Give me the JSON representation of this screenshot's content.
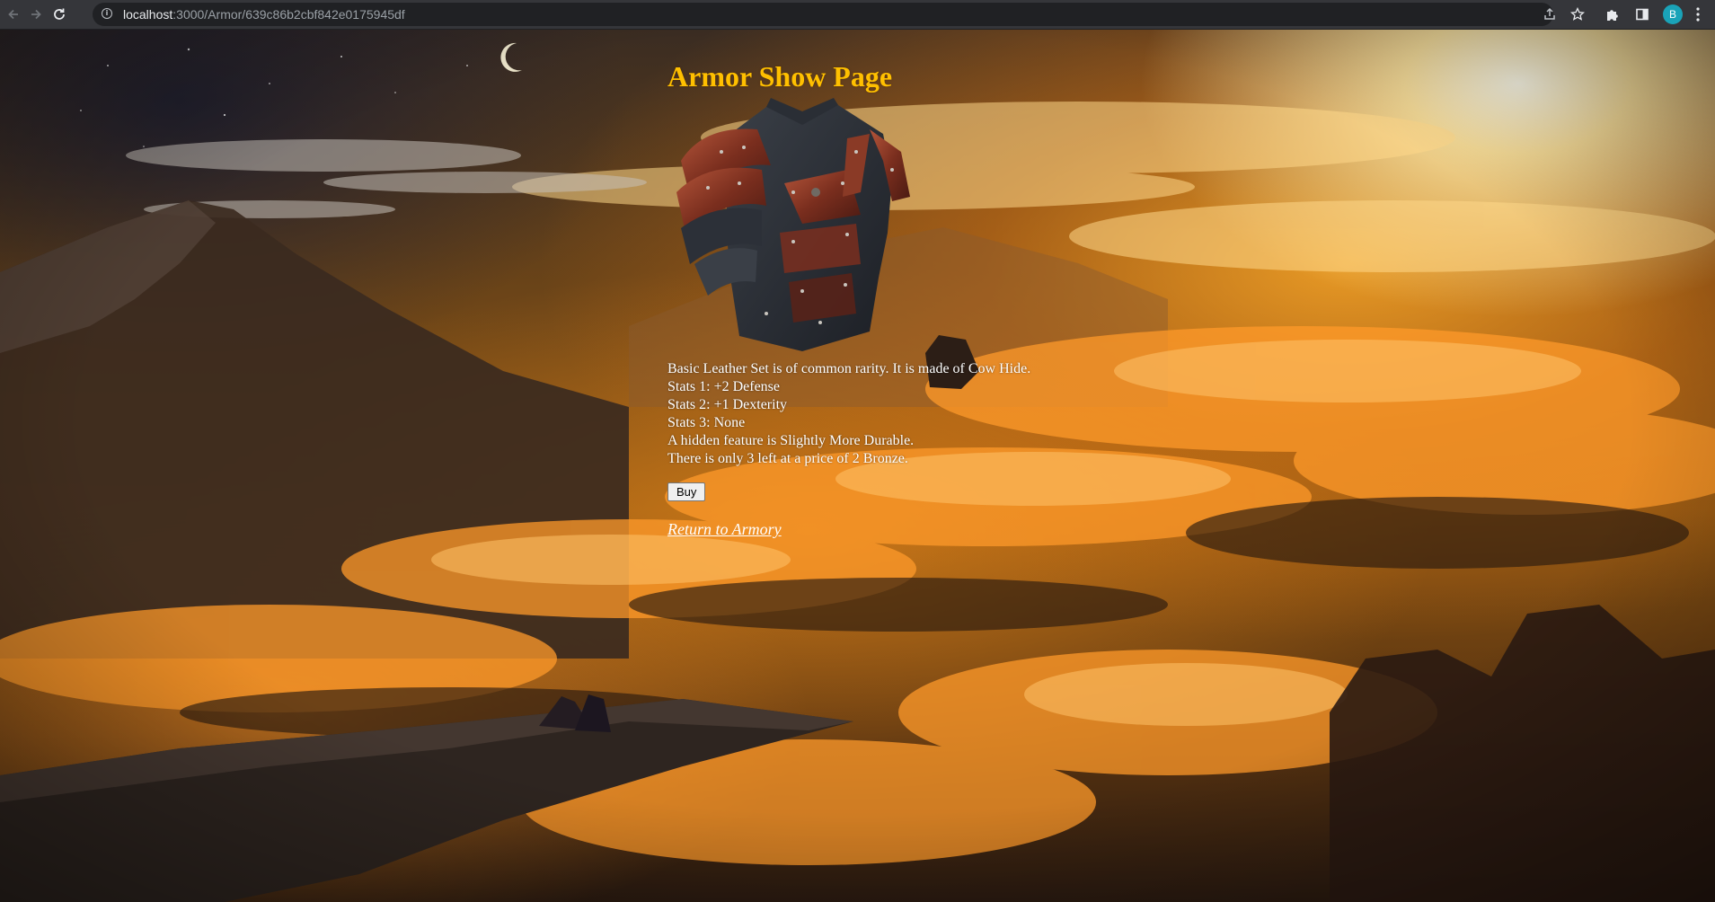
{
  "browser": {
    "url_host": "localhost",
    "url_path": ":3000/Armor/639c86b2cbf842e0175945df",
    "profile_initial": "B"
  },
  "page": {
    "title": "Armor Show Page",
    "description_lines": [
      "Basic Leather Set is of common rarity. It is made of Cow Hide.",
      "Stats 1: +2 Defense",
      "Stats 2: +1 Dexterity",
      "Stats 3: None",
      "A hidden feature is Slightly More Durable.",
      "There is only 3 left at a price of 2 Bronze."
    ],
    "buy_label": "Buy",
    "return_link": "Return to Armory"
  },
  "colors": {
    "title": "#ffc000",
    "text": "#ffffff",
    "chrome": "#35363a",
    "profile": "#1aa3b8"
  },
  "icons": {
    "back": "back-arrow-icon",
    "forward": "forward-arrow-icon",
    "reload": "reload-icon",
    "site_info": "info-icon",
    "share": "share-icon",
    "bookmark": "star-icon",
    "extensions": "puzzle-icon",
    "side_panel": "side-panel-icon",
    "menu": "kebab-menu-icon"
  }
}
